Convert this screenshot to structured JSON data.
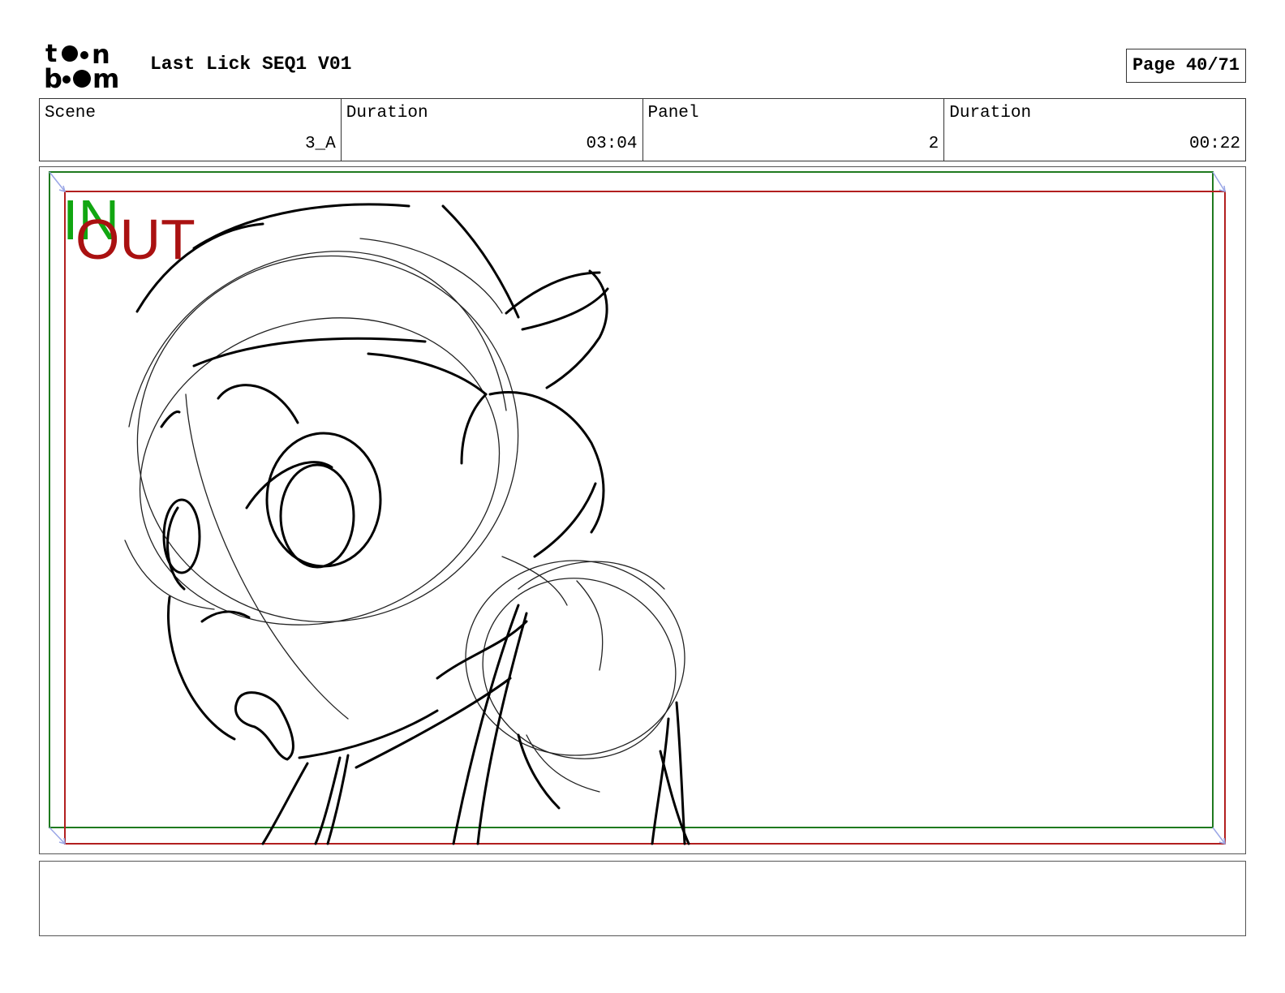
{
  "header": {
    "logo_text": "toon boom",
    "title": "Last Lick SEQ1 V01",
    "page_label": "Page 40/71"
  },
  "info": {
    "scene_label": "Scene",
    "scene_value": "3_A",
    "scene_duration_label": "Duration",
    "scene_duration_value": "03:04",
    "panel_label": "Panel",
    "panel_value": "2",
    "panel_duration_label": "Duration",
    "panel_duration_value": "00:22"
  },
  "panel": {
    "in_label": "IN",
    "out_label": "OUT",
    "in_color": "#11a611",
    "out_color": "#aa1111"
  },
  "notes": {
    "text": ""
  }
}
